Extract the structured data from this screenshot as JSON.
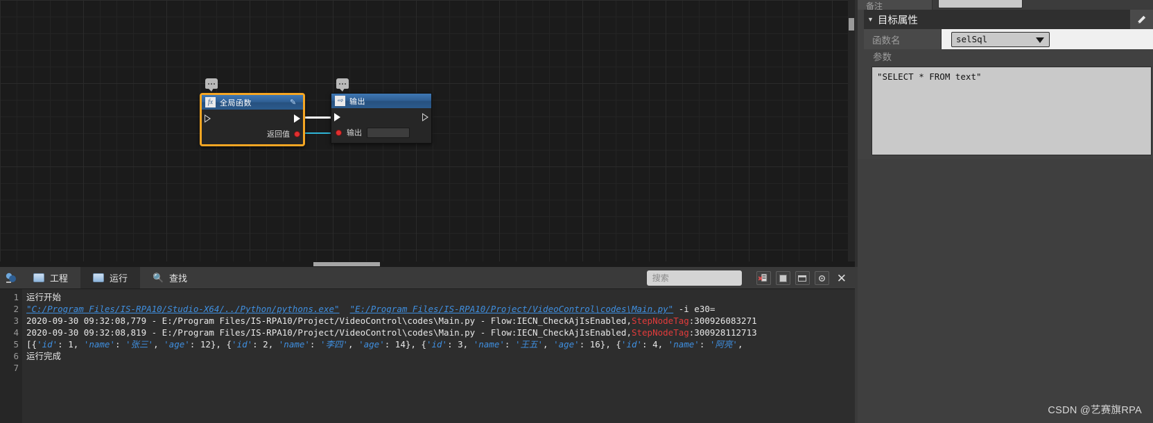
{
  "canvas": {
    "nodes": [
      {
        "id": "global-function",
        "title": "全局函数",
        "icon": "function-fx-icon",
        "selected": true,
        "rows": [
          {
            "label": "",
            "kind": "exec-in-out"
          },
          {
            "label": "返回值",
            "kind": "data-out"
          }
        ]
      },
      {
        "id": "output",
        "title": "输出",
        "icon": "output-arrow-icon",
        "selected": false,
        "rows": [
          {
            "label": "",
            "kind": "exec-in"
          },
          {
            "label": "输出",
            "kind": "data-in",
            "value": ""
          }
        ]
      }
    ]
  },
  "bottom": {
    "app_icon": "studio-logo-icon",
    "tabs": [
      {
        "id": "project",
        "label": "工程",
        "icon": "project-icon",
        "active": false
      },
      {
        "id": "run",
        "label": "运行",
        "icon": "run-console-icon",
        "active": true
      },
      {
        "id": "find",
        "label": "查找",
        "icon": "magnifier-icon",
        "active": false
      }
    ],
    "search": {
      "placeholder": "搜索",
      "value": "",
      "icon": "search-icon"
    },
    "tools": [
      {
        "id": "clear-log",
        "icon": "clear-log-icon"
      },
      {
        "id": "stop",
        "icon": "stop-square-icon"
      },
      {
        "id": "restore-window",
        "icon": "restore-window-icon"
      },
      {
        "id": "settings",
        "icon": "gear-icon"
      }
    ],
    "close_label": "✕"
  },
  "console": {
    "line_numbers": [
      "1",
      "2",
      "3",
      "4",
      "5",
      "6",
      "7"
    ],
    "lines": [
      {
        "n": 1,
        "segments": [
          {
            "t": "运行开始",
            "style": "plain"
          }
        ]
      },
      {
        "n": 2,
        "segments": [
          {
            "t": "\"C:/Program Files/IS-RPA10/Studio-X64/../Python/pythons.exe\"",
            "style": "link"
          },
          {
            "t": "  ",
            "style": "plain"
          },
          {
            "t": "\"E:/Program Files/IS-RPA10/Project/VideoControl\\codes\\Main.py\"",
            "style": "link"
          },
          {
            "t": " -i e30=",
            "style": "plain"
          }
        ]
      },
      {
        "n": 3,
        "segments": [
          {
            "t": "2020-09-30 09:32:08,779 - E:/Program Files/IS-RPA10/Project/VideoControl\\codes\\Main.py - Flow:IECN_CheckAjIsEnabled,",
            "style": "plain"
          },
          {
            "t": "StepNodeTag",
            "style": "tag"
          },
          {
            "t": ":300926083271",
            "style": "plain"
          }
        ]
      },
      {
        "n": 4,
        "segments": [
          {
            "t": "2020-09-30 09:32:08,819 - E:/Program Files/IS-RPA10/Project/VideoControl\\codes\\Main.py - Flow:IECN_CheckAjIsEnabled,",
            "style": "plain"
          },
          {
            "t": "StepNodeTag",
            "style": "tag"
          },
          {
            "t": ":300928112713",
            "style": "plain"
          }
        ]
      },
      {
        "n": 5,
        "segments": [
          {
            "t": "[{",
            "style": "plain"
          },
          {
            "t": "'id'",
            "style": "blue"
          },
          {
            "t": ": 1, ",
            "style": "plain"
          },
          {
            "t": "'name'",
            "style": "blue"
          },
          {
            "t": ": ",
            "style": "plain"
          },
          {
            "t": "'张三'",
            "style": "blue"
          },
          {
            "t": ", ",
            "style": "plain"
          },
          {
            "t": "'age'",
            "style": "blue"
          },
          {
            "t": ": 12}, {",
            "style": "plain"
          },
          {
            "t": "'id'",
            "style": "blue"
          },
          {
            "t": ": 2, ",
            "style": "plain"
          },
          {
            "t": "'name'",
            "style": "blue"
          },
          {
            "t": ": ",
            "style": "plain"
          },
          {
            "t": "'李四'",
            "style": "blue"
          },
          {
            "t": ", ",
            "style": "plain"
          },
          {
            "t": "'age'",
            "style": "blue"
          },
          {
            "t": ": 14}, {",
            "style": "plain"
          },
          {
            "t": "'id'",
            "style": "blue"
          },
          {
            "t": ": 3, ",
            "style": "plain"
          },
          {
            "t": "'name'",
            "style": "blue"
          },
          {
            "t": ": ",
            "style": "plain"
          },
          {
            "t": "'王五'",
            "style": "blue"
          },
          {
            "t": ", ",
            "style": "plain"
          },
          {
            "t": "'age'",
            "style": "blue"
          },
          {
            "t": ": 16}, {",
            "style": "plain"
          },
          {
            "t": "'id'",
            "style": "blue"
          },
          {
            "t": ": 4, ",
            "style": "plain"
          },
          {
            "t": "'name'",
            "style": "blue"
          },
          {
            "t": ": ",
            "style": "plain"
          },
          {
            "t": "'阿亮'",
            "style": "blue"
          },
          {
            "t": ",",
            "style": "plain"
          }
        ]
      },
      {
        "n": 6,
        "segments": [
          {
            "t": "运行完成",
            "style": "plain"
          }
        ]
      },
      {
        "n": 7,
        "segments": [
          {
            "t": "",
            "style": "plain"
          }
        ]
      }
    ]
  },
  "properties": {
    "partial_label": "备注",
    "section_title": "目标属性",
    "collapse_icon": "caret-down-icon",
    "edit_icon": "pencil-edit-icon",
    "func_label": "函数名",
    "func_value": "selSql",
    "func_options": [
      "selSql"
    ],
    "params_label": "参数",
    "params_value": "\"SELECT * FROM text\""
  },
  "watermark": "CSDN @艺赛旗RPA",
  "colors": {
    "accent_selected": "#f5a623",
    "node_header_blue": "#2f5f93",
    "link_blue": "#3f8fe0",
    "tag_red": "#e23b3b",
    "wire_cyan": "#2fb6d8",
    "canvas_bg": "#1b1b1b",
    "panel_bg": "#414141"
  }
}
